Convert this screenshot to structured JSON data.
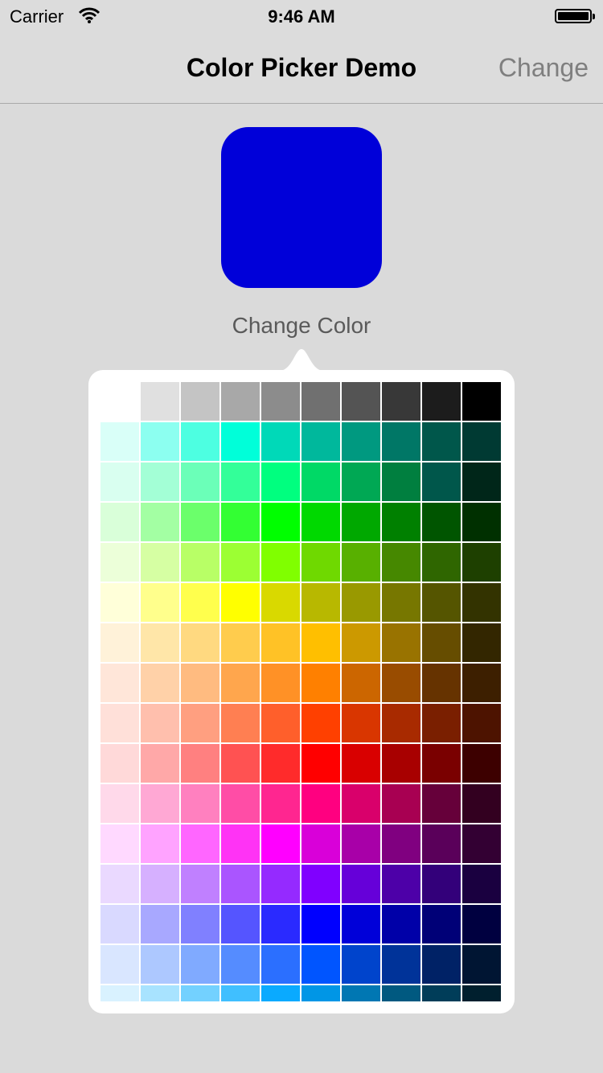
{
  "status_bar": {
    "carrier": "Carrier",
    "time": "9:46 AM",
    "wifi_icon": "wifi-icon",
    "battery_icon": "battery-icon",
    "battery_level": 1.0
  },
  "nav": {
    "title": "Color Picker Demo",
    "right_button": "Change"
  },
  "swatch": {
    "color": "#0000d9"
  },
  "change_color_label": "Change Color",
  "palette": {
    "columns": 10,
    "rows": [
      [
        "#ffffff",
        "#e0e0e0",
        "#c4c4c4",
        "#a8a8a8",
        "#8c8c8c",
        "#707070",
        "#545454",
        "#383838",
        "#1c1c1c",
        "#000000"
      ],
      [
        "#d9fff8",
        "#8cfff0",
        "#4dffe1",
        "#00ffd9",
        "#00d9b8",
        "#00b89c",
        "#009980",
        "#007766",
        "#00574b",
        "#003a33"
      ],
      [
        "#d9fff0",
        "#a3ffd6",
        "#6bffb8",
        "#33ff99",
        "#00ff7f",
        "#00d966",
        "#00a854",
        "#007f3f",
        "#00574b",
        "#002619"
      ],
      [
        "#d9ffd9",
        "#a3ffa3",
        "#6bff6b",
        "#33ff33",
        "#00ff00",
        "#00d900",
        "#00a800",
        "#008000",
        "#005500",
        "#003000"
      ],
      [
        "#ecffd9",
        "#d6ffa3",
        "#b8ff66",
        "#9cff33",
        "#80ff00",
        "#6fd900",
        "#58b000",
        "#468800",
        "#2f6600",
        "#1e4000"
      ],
      [
        "#ffffd9",
        "#ffff8c",
        "#ffff4d",
        "#ffff00",
        "#d9d900",
        "#b8b800",
        "#999900",
        "#777700",
        "#555500",
        "#333300"
      ],
      [
        "#fff2d9",
        "#ffe6a8",
        "#ffd980",
        "#ffcc4d",
        "#ffc226",
        "#ffbf00",
        "#cc9900",
        "#997300",
        "#664d00",
        "#332600"
      ],
      [
        "#ffe6d9",
        "#ffd1a8",
        "#ffbb80",
        "#ffa64d",
        "#ff9126",
        "#ff8000",
        "#cc6600",
        "#994c00",
        "#663300",
        "#3d1f00"
      ],
      [
        "#ffe0d9",
        "#ffbfad",
        "#ff9f80",
        "#ff7f52",
        "#ff5f2b",
        "#ff4000",
        "#d93600",
        "#a82a00",
        "#7a1f00",
        "#4d1300"
      ],
      [
        "#ffd9d9",
        "#ffa8a8",
        "#ff8080",
        "#ff5252",
        "#ff2b2b",
        "#ff0000",
        "#d90000",
        "#a80000",
        "#7a0000",
        "#3d0000"
      ],
      [
        "#ffd9ea",
        "#ffa8d4",
        "#ff80bf",
        "#ff4da6",
        "#ff2690",
        "#ff0080",
        "#d9006b",
        "#a80052",
        "#66003a",
        "#330020"
      ],
      [
        "#ffd9ff",
        "#ffa3ff",
        "#ff66ff",
        "#ff33f5",
        "#ff00ff",
        "#d900d9",
        "#a800a8",
        "#800080",
        "#5a005a",
        "#330033"
      ],
      [
        "#ead9ff",
        "#d6b0ff",
        "#c080ff",
        "#aa55ff",
        "#952aff",
        "#8000ff",
        "#6600d9",
        "#4d00a8",
        "#33007a",
        "#1a0040"
      ],
      [
        "#d9d9ff",
        "#a8a8ff",
        "#8080ff",
        "#5555ff",
        "#2a2aff",
        "#0000ff",
        "#0000d9",
        "#0000a8",
        "#000077",
        "#000040"
      ],
      [
        "#d9e6ff",
        "#adc8ff",
        "#80aaff",
        "#558cff",
        "#2b6fff",
        "#0055ff",
        "#0044cc",
        "#003399",
        "#002266",
        "#001533"
      ],
      [
        "#d9f2ff",
        "#a8e3ff",
        "#73d1ff",
        "#40bfff",
        "#0aaaff",
        "#0096e6",
        "#0077b3",
        "#005980",
        "#003d59",
        "#001f2e"
      ]
    ]
  }
}
